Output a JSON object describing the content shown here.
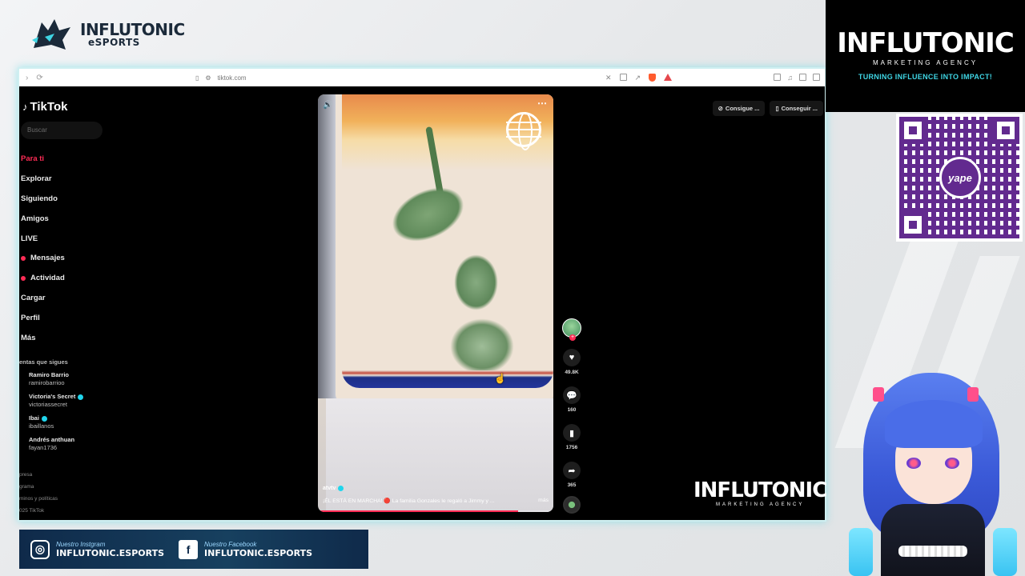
{
  "overlay": {
    "brand_tl": {
      "line1": "INFLUTONIC",
      "line2": "eSPORTS"
    },
    "brand_tr": {
      "name": "INFLUTONIC",
      "sub": "MARKETING AGENCY",
      "tagline": "TURNING INFLUENCE INTO IMPACT!"
    },
    "brand_inner": {
      "name": "INFLUTONIC",
      "sub": "MARKETING AGENCY"
    },
    "qr": {
      "label": "yape"
    },
    "social": [
      {
        "icon": "instagram-icon",
        "title": "Nuestro Instgram",
        "handle": "INFLUTONIC.ESPORTS"
      },
      {
        "icon": "facebook-icon",
        "title": "Nuestro Facebook",
        "handle": "INFLUTONIC.ESPORTS"
      }
    ]
  },
  "browser": {
    "url": "tiktok.com"
  },
  "tiktok": {
    "logo": "TikTok",
    "search_placeholder": "Buscar",
    "menu": [
      {
        "label": "Para ti",
        "active": true
      },
      {
        "label": "Explorar"
      },
      {
        "label": "Siguiendo"
      },
      {
        "label": "Amigos"
      },
      {
        "label": "LIVE"
      },
      {
        "label": "Mensajes"
      },
      {
        "label": "Actividad"
      },
      {
        "label": "Cargar"
      },
      {
        "label": "Perfil"
      },
      {
        "label": "Más"
      }
    ],
    "following_title": "entas que sigues",
    "following": [
      {
        "name": "Ramiro Barrio",
        "handle": "ramirobarrioo"
      },
      {
        "name": "Victoria's Secret",
        "handle": "victoriassecret",
        "verified": true
      },
      {
        "name": "Ibai",
        "handle": "ibaillanos",
        "verified": true
      },
      {
        "name": "Andrés anthuan",
        "handle": "fayan1736"
      }
    ],
    "footer": [
      "presa",
      "grama",
      "minos y políticas",
      "025 TikTok"
    ],
    "top_buttons": [
      "Consigue ...",
      "Conseguir ..."
    ],
    "video": {
      "author": "atvtv",
      "caption": "¡ÉL ESTÁ EN MARCHA! 🔴 La familia Gonzales le regaló a Jimmy y ...",
      "more": "más",
      "progress": 0.85
    },
    "actions": {
      "likes": "49.8K",
      "comments": "160",
      "saves": "1756",
      "shares": "365"
    }
  }
}
